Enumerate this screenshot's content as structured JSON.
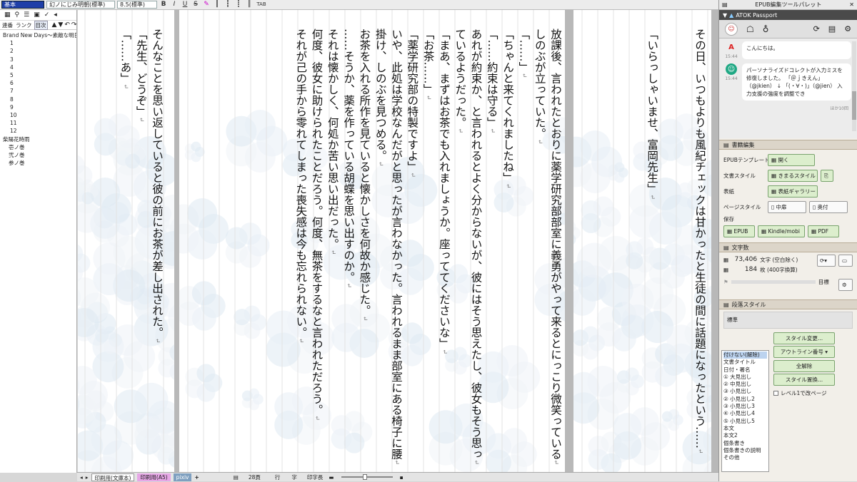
{
  "toolbar": {
    "style_value": "基本",
    "font_value": "幻ノにじみ明朝(標準)",
    "size_value": "8.5(標準)",
    "bold": "B",
    "italic": "I",
    "underline": "U",
    "strike": "S",
    "tab_label": "TAB"
  },
  "left_panel": {
    "tabs": [
      "連番",
      "ランク",
      "目次"
    ],
    "toc": [
      {
        "label": "Brand New Days〜素敵な明日を",
        "level": 0
      },
      {
        "label": "1",
        "level": 1
      },
      {
        "label": "2",
        "level": 1
      },
      {
        "label": "3",
        "level": 1
      },
      {
        "label": "4",
        "level": 1
      },
      {
        "label": "5",
        "level": 1
      },
      {
        "label": "6",
        "level": 1
      },
      {
        "label": "7",
        "level": 1
      },
      {
        "label": "8",
        "level": 1
      },
      {
        "label": "9",
        "level": 1
      },
      {
        "label": "10",
        "level": 1
      },
      {
        "label": "11",
        "level": 1
      },
      {
        "label": "12",
        "level": 1
      },
      {
        "label": "柴陽花時雨",
        "level": 0
      },
      {
        "label": "壱ノ巻",
        "level": 2
      },
      {
        "label": "弐ノ巻",
        "level": 2
      },
      {
        "label": "参ノ巻",
        "level": 2
      }
    ]
  },
  "pages": {
    "right": [
      "その日、いつもよりも風紀チェックは甘かったと生徒の間に話題になったという……",
      "",
      "",
      "「いらっしゃいませ、富岡先生」"
    ],
    "middle": [
      "放課後、言われたとおりに薬学研究部部室に義勇がやって来るとにっこり微笑っている",
      "しのぶが立っていた。",
      "「……」",
      "「ちゃんと来てくれましたね」",
      "「……約束は守る」",
      "あれが約束か、と言われるとよく分からないが、彼にはそう思えたし、彼女もそう思っ",
      "ているようだった。",
      "「まあ、まずはお茶でも入れましょうか。座っててくださいな」",
      "「お茶……」",
      "「薬学研究部の特製ですよ」",
      "いや、此処は学校なんだがと思ったが言わなかった。言われるまま部室にある椅子に腰",
      "掛け、しのぶを見つめる。",
      "お茶を入れる所作を見ていると懐かしさを何故か感じた。",
      "……そうか、薬を作っている胡蝶を思い出すのか。",
      "それは懐かしく、何処か苦い思い出だった。",
      "何度、彼女に助けられたことだろう。何度、無茶をするなと言われただろう。",
      "それが己の手から零れてしまった喪失感は今も忘れられない。"
    ],
    "left": [
      "そんなことを思い返していると彼の前にお茶が差し出された。",
      "「先生、どうぞ」",
      "「……あ」"
    ]
  },
  "status_bar": {
    "sheet_tabs": [
      "印刷用(文庫本)",
      "印刷用(A5)",
      "pixiv"
    ],
    "page_num": "28頁",
    "row_label": "行",
    "char_label": "字",
    "width_label": "印字長"
  },
  "right_panel": {
    "title": "EPUB編集ツールパレット",
    "atok": {
      "header": "ATOK Passport",
      "messages": [
        {
          "time": "15:44",
          "text": "こんにちは。"
        },
        {
          "time": "15:44",
          "text": "パーソナライズドコレクトが入力ミスを修復しました。 「＠ｊきえん」（@jkien） ↓ 「(・∀・)」（@jien） 入力支援の強度を調整でき"
        }
      ],
      "note": "ほか10回"
    },
    "book_edit": {
      "title": "書籍編集",
      "template_label": "EPUBテンプレート",
      "open_btn": "開く",
      "doc_style_label": "文書スタイル",
      "doc_style_btn": "きまるスタイル",
      "cover_label": "表紙",
      "cover_btn": "表紙ギャラリー",
      "page_style_label": "ページスタイル",
      "page_btn1": "中扉",
      "page_btn2": "奥付",
      "save_label": "保存",
      "save_epub": "EPUB",
      "save_kindle": "Kindle/mobi",
      "save_pdf": "PDF"
    },
    "char_count": {
      "title": "文字数",
      "chars": "73,406",
      "chars_unit": "文字 (空白除く)",
      "sheets": "184",
      "sheets_unit": "枚 (400字換算)",
      "goal_label": "目標"
    },
    "para_style": {
      "title": "段落スタイル",
      "current": "標準",
      "list": [
        "付けない(解除)",
        "文書タイトル",
        "日付・署名",
        "① 大見出し",
        "② 中見出し",
        "③ 小見出し",
        "② 小見出し2",
        "③ 小見出し3",
        "④ 小見出し4",
        "⑤ 小見出し5",
        "本文",
        "本文2",
        "個条書き",
        "個条書きの説明",
        "その他"
      ],
      "btn_change": "スタイル変更...",
      "btn_outline": "アウトライン番号",
      "btn_clear": "全解除",
      "btn_replace": "スタイル置換...",
      "checkbox_label": "レベル1で改ページ"
    }
  }
}
